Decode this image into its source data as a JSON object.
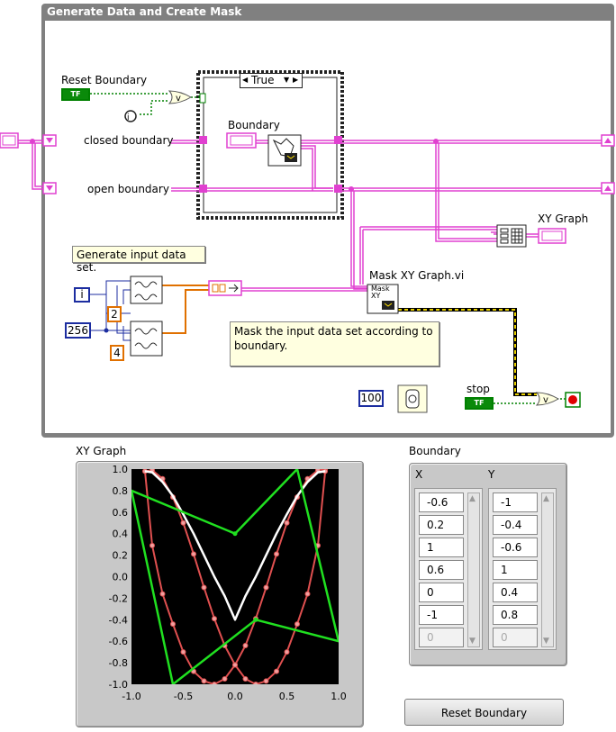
{
  "diagram": {
    "loop_title": "Generate Data and Create Mask",
    "reset_boundary_label": "Reset Boundary",
    "bool_const_text": "TF",
    "case_selector": "True",
    "boundary_label": "Boundary",
    "closed_boundary_label": "closed boundary",
    "open_boundary_label": "open boundary",
    "xy_graph_label": "XY Graph",
    "generate_comment": "Generate input data set.",
    "mask_vi_label": "Mask XY Graph.vi",
    "mask_icon_text": "Mask XY",
    "mask_comment": "Mask the input data set according to boundary.",
    "const_i": "i",
    "const_256": "256",
    "const_2": "2",
    "const_4": "4",
    "const_100": "100",
    "stop_label": "stop",
    "colors": {
      "wire_pink": "#e040d0",
      "wire_orange": "#e07000",
      "wire_bool": "#008000",
      "int_blue": "#1c2da0",
      "frame_gray": "#808080"
    }
  },
  "front_panel": {
    "xy_graph": {
      "label": "XY Graph",
      "x_ticks": [
        "-1.0",
        "-0.5",
        "0.0",
        "0.5",
        "1.0"
      ],
      "y_ticks": [
        "1.0",
        "0.8",
        "0.6",
        "0.4",
        "0.2",
        "0.0",
        "-0.2",
        "-0.4",
        "-0.6",
        "-0.8",
        "-1.0"
      ]
    },
    "boundary": {
      "label": "Boundary",
      "x_header": "X",
      "y_header": "Y",
      "x_values": [
        "-0.6",
        "0.2",
        "1",
        "0.6",
        "0",
        "-1"
      ],
      "y_values": [
        "-1",
        "-0.4",
        "-0.6",
        "1",
        "0.4",
        "0.8"
      ],
      "x_empty": "0",
      "y_empty": "0",
      "x_index": "0",
      "y_index": "0"
    },
    "reset_button": "Reset Boundary"
  },
  "chart_data": {
    "type": "line",
    "xlim": [
      -1.0,
      1.0
    ],
    "ylim": [
      -1.0,
      1.0
    ],
    "grid": false,
    "series": [
      {
        "color": "#e05050",
        "x": [
          0.87,
          0.8,
          0.7,
          0.6,
          0.5,
          0.4,
          0.3,
          0.2,
          0.1,
          0.0,
          -0.1,
          -0.2,
          -0.3,
          -0.4,
          -0.5,
          -0.6,
          -0.7,
          -0.8,
          -0.87,
          -0.8,
          -0.7,
          -0.6,
          -0.5,
          -0.4,
          -0.3,
          -0.2,
          -0.1,
          0.0,
          0.1,
          0.2,
          0.3,
          0.4,
          0.5,
          0.6,
          0.7,
          0.8,
          0.87
        ],
        "y": [
          1.0,
          0.99,
          0.91,
          0.74,
          0.5,
          0.21,
          -0.1,
          -0.39,
          -0.64,
          -0.82,
          -0.95,
          -1.0,
          -0.97,
          -0.88,
          -0.7,
          -0.44,
          -0.16,
          0.29,
          0.98,
          0.99,
          0.91,
          0.74,
          0.5,
          0.21,
          -0.1,
          -0.39,
          -0.64,
          -0.82,
          -0.95,
          -1.0,
          -0.97,
          -0.88,
          -0.7,
          -0.44,
          -0.16,
          0.29,
          0.98
        ]
      },
      {
        "color": "#ffffff",
        "x": [
          -0.87,
          -0.8,
          -0.7,
          -0.6,
          -0.5,
          -0.4,
          -0.3,
          -0.2,
          -0.1,
          0.0,
          0.1,
          0.2,
          0.3,
          0.4,
          0.5,
          0.6,
          0.7,
          0.8,
          0.87
        ],
        "y": [
          0.98,
          0.97,
          0.88,
          0.75,
          0.58,
          0.4,
          0.2,
          0.0,
          -0.18,
          -0.4,
          -0.18,
          0.0,
          0.2,
          0.4,
          0.58,
          0.75,
          0.88,
          0.97,
          0.98
        ]
      },
      {
        "color": "#20e020",
        "x": [
          -0.6,
          0.2,
          1.0,
          0.6,
          0.0,
          -1.0,
          -0.6
        ],
        "y": [
          -1.0,
          -0.4,
          -0.6,
          1.0,
          0.4,
          0.8,
          -1.0
        ]
      }
    ]
  }
}
